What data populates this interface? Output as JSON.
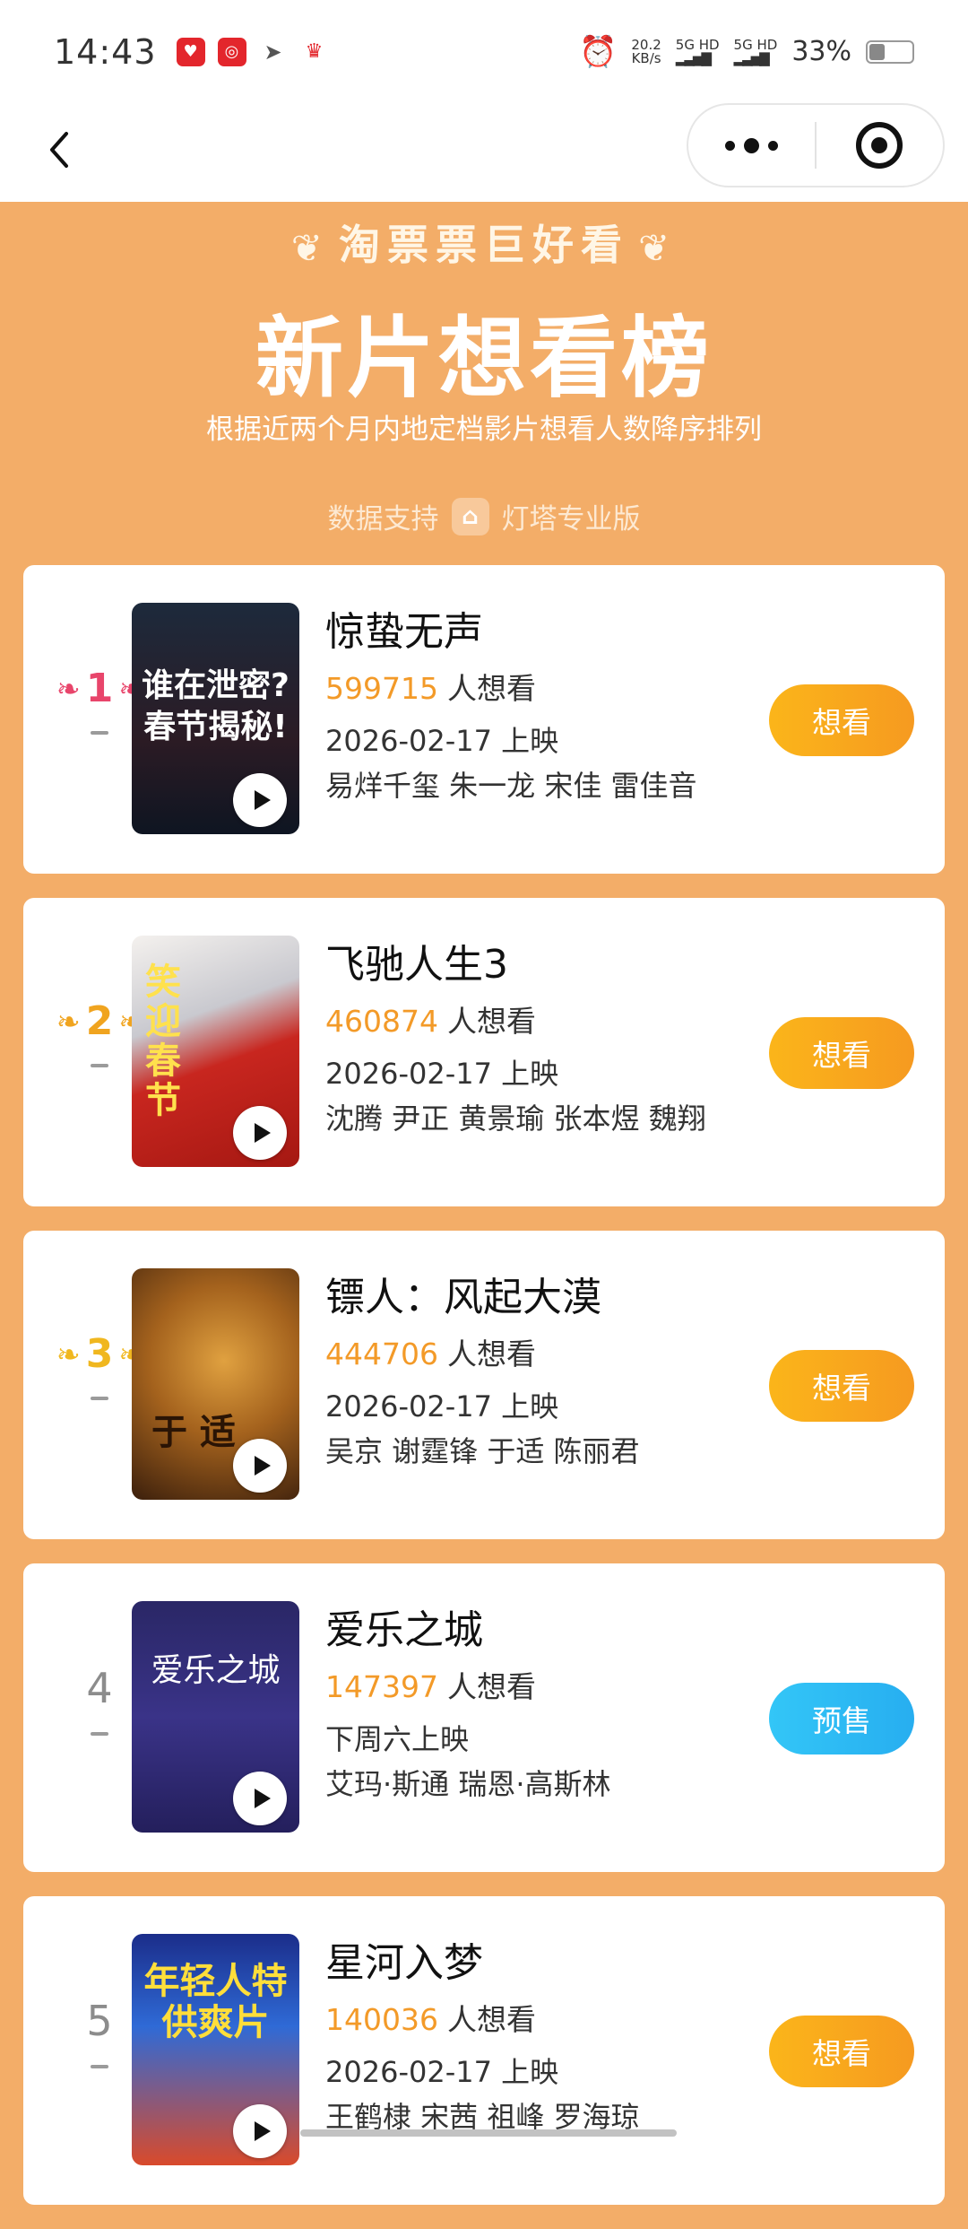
{
  "status_bar": {
    "time": "14:43",
    "net_speed": "20.2",
    "net_unit": "KB/s",
    "signal1": "5G HD",
    "signal2": "5G HD",
    "battery": "33%"
  },
  "header": {
    "brand": "淘票票巨好看",
    "title": "新片想看榜",
    "subtitle": "根据近两个月内地定档影片想看人数降序排列",
    "data_source_label": "数据支持",
    "data_source_name": "灯塔专业版"
  },
  "movies": [
    {
      "rank": "1",
      "title": "惊蛰无声",
      "want_count": "599715",
      "want_suffix": "人想看",
      "date": "2026-02-17 上映",
      "cast": "易烊千玺 朱一龙 宋佳 雷佳音",
      "button": "想看",
      "poster_text": "谁在泄密?春节揭秘!"
    },
    {
      "rank": "2",
      "title": "飞驰人生3",
      "want_count": "460874",
      "want_suffix": "人想看",
      "date": "2026-02-17 上映",
      "cast": "沈腾 尹正 黄景瑜 张本煜 魏翔",
      "button": "想看",
      "poster_text": "笑迎春节"
    },
    {
      "rank": "3",
      "title": "镖人：风起大漠",
      "want_count": "444706",
      "want_suffix": "人想看",
      "date": "2026-02-17 上映",
      "cast": "吴京 谢霆锋 于适 陈丽君",
      "button": "想看",
      "poster_text": "于 适"
    },
    {
      "rank": "4",
      "title": "爱乐之城",
      "want_count": "147397",
      "want_suffix": "人想看",
      "date": "下周六上映",
      "cast": "艾玛·斯通 瑞恩·高斯林",
      "button": "预售",
      "poster_text": "爱乐之城"
    },
    {
      "rank": "5",
      "title": "星河入梦",
      "want_count": "140036",
      "want_suffix": "人想看",
      "date": "2026-02-17 上映",
      "cast": "王鹤棣 宋茜 祖峰 罗海琼",
      "button": "想看",
      "poster_text": "年轻人特供爽片"
    }
  ]
}
